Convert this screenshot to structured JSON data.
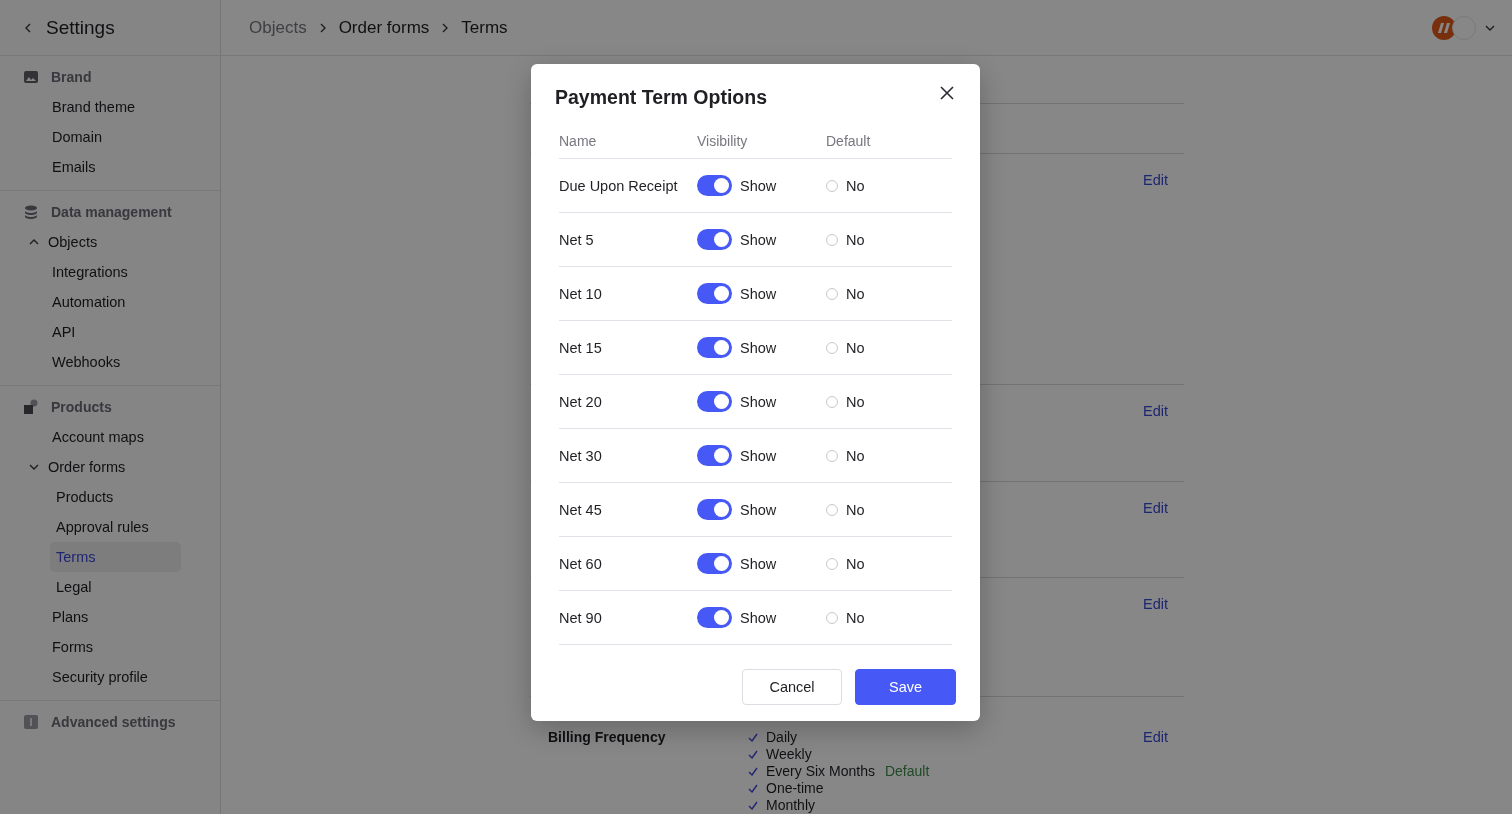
{
  "sidebar": {
    "back": "Settings",
    "groups": [
      {
        "label": "Brand",
        "items": [
          {
            "label": "Brand theme",
            "selected": false
          },
          {
            "label": "Domain",
            "selected": false
          },
          {
            "label": "Emails",
            "selected": false
          }
        ]
      },
      {
        "label": "Data management",
        "items": [
          {
            "label": "Objects",
            "selected": false,
            "expanded": false
          },
          {
            "label": "Integrations",
            "selected": false
          },
          {
            "label": "Automation",
            "selected": false
          },
          {
            "label": "API",
            "selected": false
          },
          {
            "label": "Webhooks",
            "selected": false
          }
        ]
      },
      {
        "label": "Products",
        "items": [
          {
            "label": "Account maps",
            "selected": false
          },
          {
            "label": "Order forms",
            "selected": false,
            "expanded": true,
            "children": [
              {
                "label": "Products",
                "selected": false
              },
              {
                "label": "Approval rules",
                "selected": false
              },
              {
                "label": "Terms",
                "selected": true
              },
              {
                "label": "Legal",
                "selected": false
              }
            ]
          },
          {
            "label": "Plans",
            "selected": false
          },
          {
            "label": "Forms",
            "selected": false
          },
          {
            "label": "Security profile",
            "selected": false
          }
        ]
      },
      {
        "label": "Advanced settings"
      }
    ]
  },
  "breadcrumbs": [
    {
      "label": "Objects",
      "current": false
    },
    {
      "label": "Order forms",
      "current": true
    },
    {
      "label": "Terms",
      "current": true
    }
  ],
  "content": {
    "sections": [
      {
        "edit": "Edit"
      },
      {
        "edit": "Edit"
      },
      {
        "edit": "Edit"
      },
      {
        "edit": "Edit"
      }
    ],
    "billing": {
      "label": "Billing Frequency",
      "edit": "Edit",
      "options": [
        {
          "label": "Daily"
        },
        {
          "label": "Weekly"
        },
        {
          "label": "Every Six Months",
          "badge": "Default"
        },
        {
          "label": "One-time"
        },
        {
          "label": "Monthly"
        }
      ]
    }
  },
  "dialog": {
    "title": "Payment Term Options",
    "columns": [
      "Name",
      "Visibility",
      "Default"
    ],
    "rows": [
      {
        "name": "Due Upon Receipt",
        "visible": true,
        "visibility": "Show",
        "default": false,
        "default_label": "No"
      },
      {
        "name": "Net 5",
        "visible": true,
        "visibility": "Show",
        "default": false,
        "default_label": "No"
      },
      {
        "name": "Net 10",
        "visible": true,
        "visibility": "Show",
        "default": false,
        "default_label": "No"
      },
      {
        "name": "Net 15",
        "visible": true,
        "visibility": "Show",
        "default": false,
        "default_label": "No"
      },
      {
        "name": "Net 20",
        "visible": true,
        "visibility": "Show",
        "default": false,
        "default_label": "No"
      },
      {
        "name": "Net 30",
        "visible": true,
        "visibility": "Show",
        "default": false,
        "default_label": "No"
      },
      {
        "name": "Net 45",
        "visible": true,
        "visibility": "Show",
        "default": false,
        "default_label": "No"
      },
      {
        "name": "Net 60",
        "visible": true,
        "visibility": "Show",
        "default": false,
        "default_label": "No"
      },
      {
        "name": "Net 90",
        "visible": true,
        "visibility": "Show",
        "default": false,
        "default_label": "No"
      }
    ],
    "cancel": "Cancel",
    "save": "Save"
  }
}
